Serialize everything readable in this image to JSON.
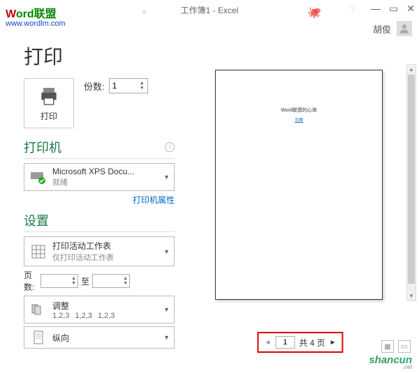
{
  "overlay": {
    "brand_w": "W",
    "brand_rest": "ord联盟",
    "url": "www.wordlm.com"
  },
  "titlebar": {
    "title": "工作簿1 - Excel"
  },
  "user": {
    "name": "胡俊"
  },
  "page": {
    "title": "打印",
    "print_btn_label": "打印",
    "copies_label": "份数:",
    "copies_value": "1"
  },
  "printer": {
    "section": "打印机",
    "name": "Microsoft XPS Docu...",
    "status": "就绪",
    "props_link": "打印机属性"
  },
  "settings": {
    "section": "设置",
    "scope_title": "打印活动工作表",
    "scope_sub": "仅打印活动工作表",
    "pages_label": "页数:",
    "pages_to": "至",
    "collate_title": "调整",
    "collate_sub1": "1,2,3",
    "collate_sub2": "1,2,3",
    "collate_sub3": "1,2,3",
    "orient": "纵向"
  },
  "preview": {
    "doc_line": "Word联盟的心体",
    "doc_link": "示图"
  },
  "pager": {
    "current": "1",
    "total_label": "共 4 页"
  },
  "watermark": {
    "text1": "shan",
    "text2": "cun",
    "sub": ".net"
  }
}
